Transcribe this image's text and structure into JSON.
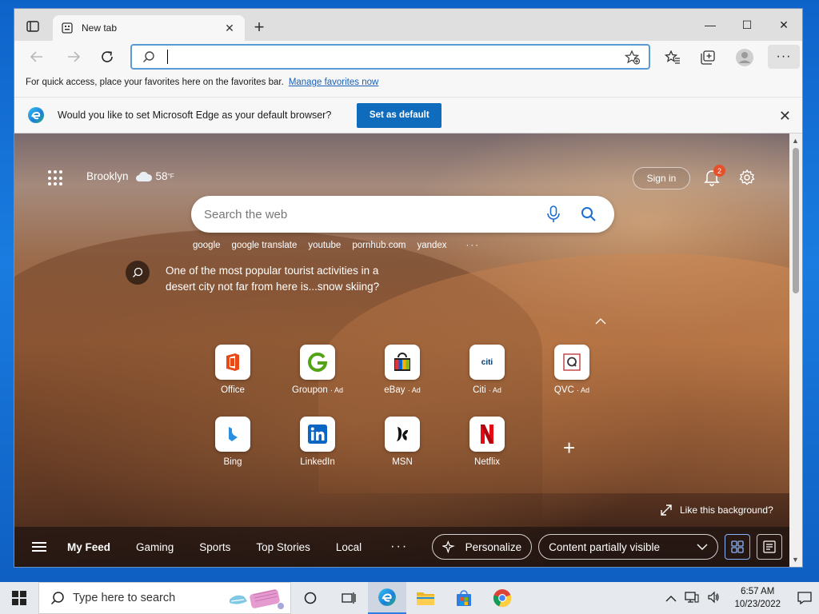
{
  "browser": {
    "tab_title": "New tab",
    "tab_close": "✕",
    "new_tab_glyph": "+",
    "window_controls": {
      "minimize": "—",
      "maximize": "☐",
      "close": "✕"
    },
    "address_value": "",
    "more_glyph": "···",
    "favbar_text": "For quick access, place your favorites here on the favorites bar.",
    "favbar_link": "Manage favorites now",
    "infobar_message": "Would you like to set Microsoft Edge as your default browser?",
    "infobar_button": "Set as default",
    "infobar_close": "✕"
  },
  "newtab": {
    "location": "Brooklyn",
    "temperature": "58",
    "temperature_unit": "°F",
    "sign_in": "Sign in",
    "notification_count": "2",
    "search_placeholder": "Search the web",
    "trending": [
      "google",
      "google translate",
      "youtube",
      "pornhub.com",
      "yandex"
    ],
    "trending_more": "···",
    "fact_text": "One of the most popular tourist activities in a desert city not far from here is...snow skiing?",
    "collapse_glyph": "^",
    "tiles": [
      {
        "name": "Office",
        "ad": ""
      },
      {
        "name": "Groupon",
        "ad": "· Ad"
      },
      {
        "name": "eBay",
        "ad": "· Ad"
      },
      {
        "name": "Citi",
        "ad": "· Ad"
      },
      {
        "name": "QVC",
        "ad": "· Ad"
      },
      {
        "name": "Bing",
        "ad": ""
      },
      {
        "name": "LinkedIn",
        "ad": ""
      },
      {
        "name": "MSN",
        "ad": ""
      },
      {
        "name": "Netflix",
        "ad": ""
      }
    ],
    "citi_logo_text": "citi",
    "add_tile_glyph": "+",
    "like_background": "Like this background?",
    "feed_tabs": [
      "My Feed",
      "Gaming",
      "Sports",
      "Top Stories",
      "Local"
    ],
    "feed_more": "···",
    "personalize": "Personalize",
    "content_visibility": "Content partially visible"
  },
  "taskbar": {
    "search_placeholder": "Type here to search",
    "time": "6:57 AM",
    "date": "10/23/2022"
  },
  "colors": {
    "accent": "#0f6cbd",
    "badge": "#e8502a",
    "taskbar": "#e6e9ee"
  }
}
